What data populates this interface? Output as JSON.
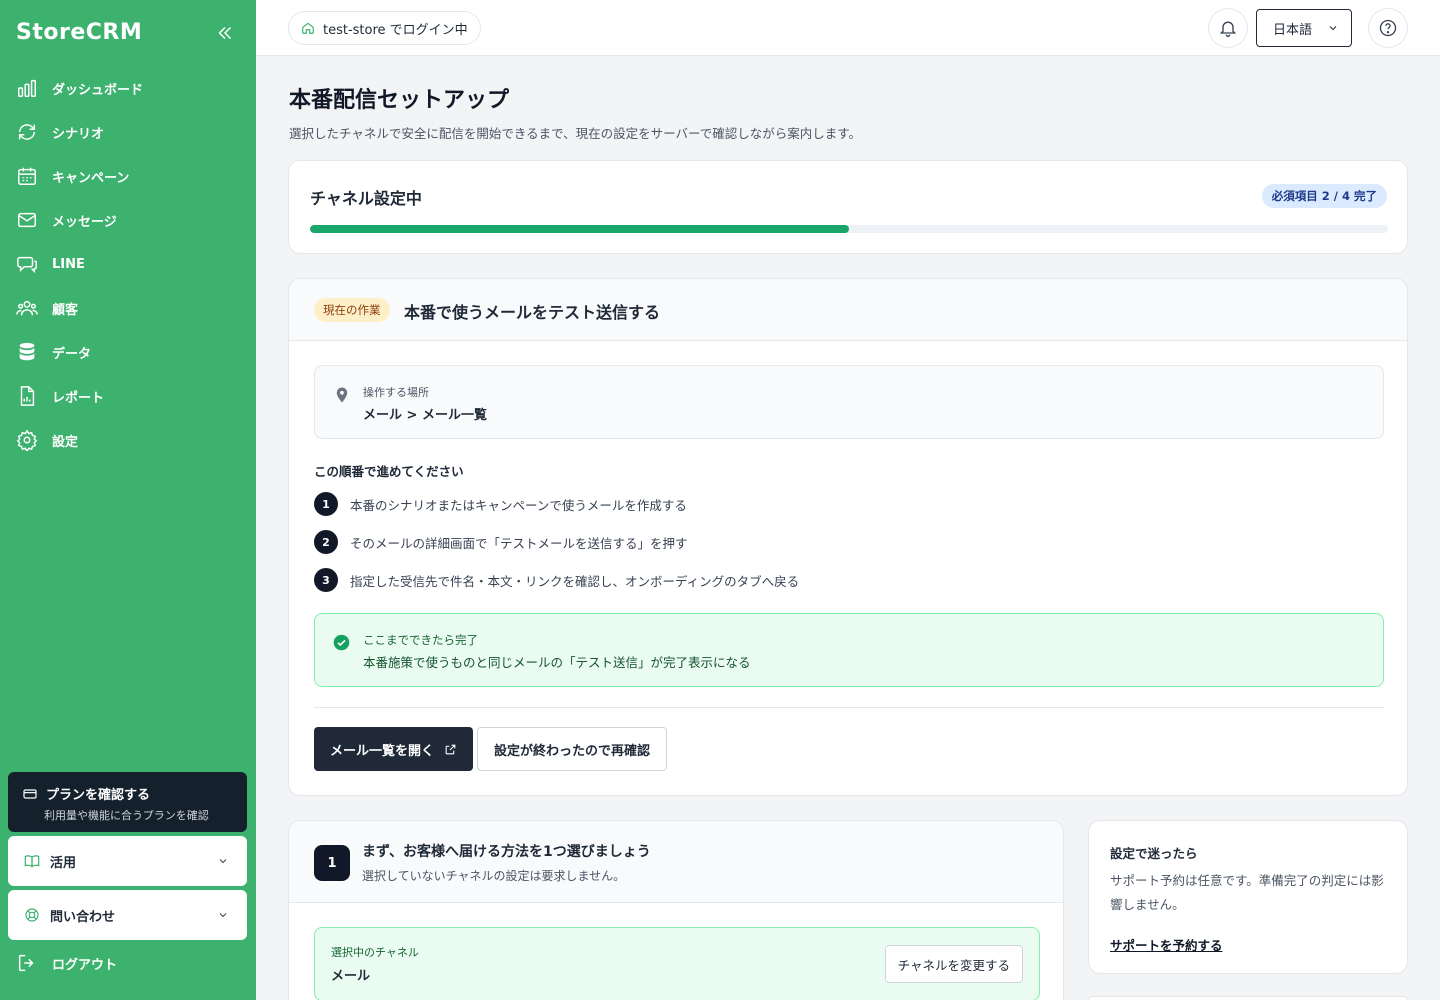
{
  "brand": "StoreCRM",
  "sidebar": {
    "items": [
      {
        "label": "ダッシュボード",
        "icon": "chart-bar-icon"
      },
      {
        "label": "シナリオ",
        "icon": "refresh-icon"
      },
      {
        "label": "キャンペーン",
        "icon": "calendar-icon"
      },
      {
        "label": "メッセージ",
        "icon": "mail-icon"
      },
      {
        "label": "LINE",
        "icon": "chat-icon"
      },
      {
        "label": "顧客",
        "icon": "users-icon"
      },
      {
        "label": "データ",
        "icon": "database-icon"
      },
      {
        "label": "レポート",
        "icon": "report-icon"
      },
      {
        "label": "設定",
        "icon": "gear-icon"
      }
    ],
    "plan": {
      "title": "プランを確認する",
      "subtitle": "利用量や機能に合うプランを確認"
    },
    "accordions": [
      {
        "label": "活用",
        "icon": "book-icon"
      },
      {
        "label": "問い合わせ",
        "icon": "lifebuoy-icon"
      }
    ],
    "logout": "ログアウト"
  },
  "header": {
    "store": "test-store でログイン中",
    "language": "日本語"
  },
  "main": {
    "title": "本番配信セットアップ",
    "subtitle": "選択したチャネルで安全に配信を開始できるまで、現在の設定をサーバーで確認しながら案内します。"
  },
  "progress": {
    "title": "チャネル設定中",
    "badge": "必須項目 2 / 4 完了",
    "completed": 2,
    "total": 4,
    "percent": 50,
    "color": "#1aa56a"
  },
  "task": {
    "badge": "現在の作業",
    "title": "本番で使うメールをテスト送信する",
    "location_label": "操作する場所",
    "location_path": "メール > メール一覧",
    "steps_heading": "この順番で進めてください",
    "steps": [
      {
        "num": "1",
        "text": "本番のシナリオまたはキャンペーンで使うメールを作成する"
      },
      {
        "num": "2",
        "text": "そのメールの詳細画面で「テストメールを送信する」を押す"
      },
      {
        "num": "3",
        "text": "指定した受信先で件名・本文・リンクを確認し、オンボーディングのタブへ戻る"
      }
    ],
    "done_label": "ここまでできたら完了",
    "done_text": "本番施策で使うものと同じメールの「テスト送信」が完了表示になる",
    "primary_button": "メール一覧を開く",
    "secondary_button": "設定が終わったので再確認"
  },
  "channel": {
    "num": "1",
    "title": "まず、お客様へ届ける方法を1つ選びましょう",
    "subtitle": "選択していないチャネルの設定は要求しません。",
    "selected_label": "選択中のチャネル",
    "selected_value": "メール",
    "change_button": "チャネルを変更する"
  },
  "support": {
    "title": "設定で迷ったら",
    "text": "サポート予約は任意です。準備完了の判定には影響しません。",
    "link": "サポートを予約する"
  },
  "colors": {
    "sidebar": "#3db16e",
    "accent": "#1aa56a",
    "dark": "#1f2937"
  }
}
